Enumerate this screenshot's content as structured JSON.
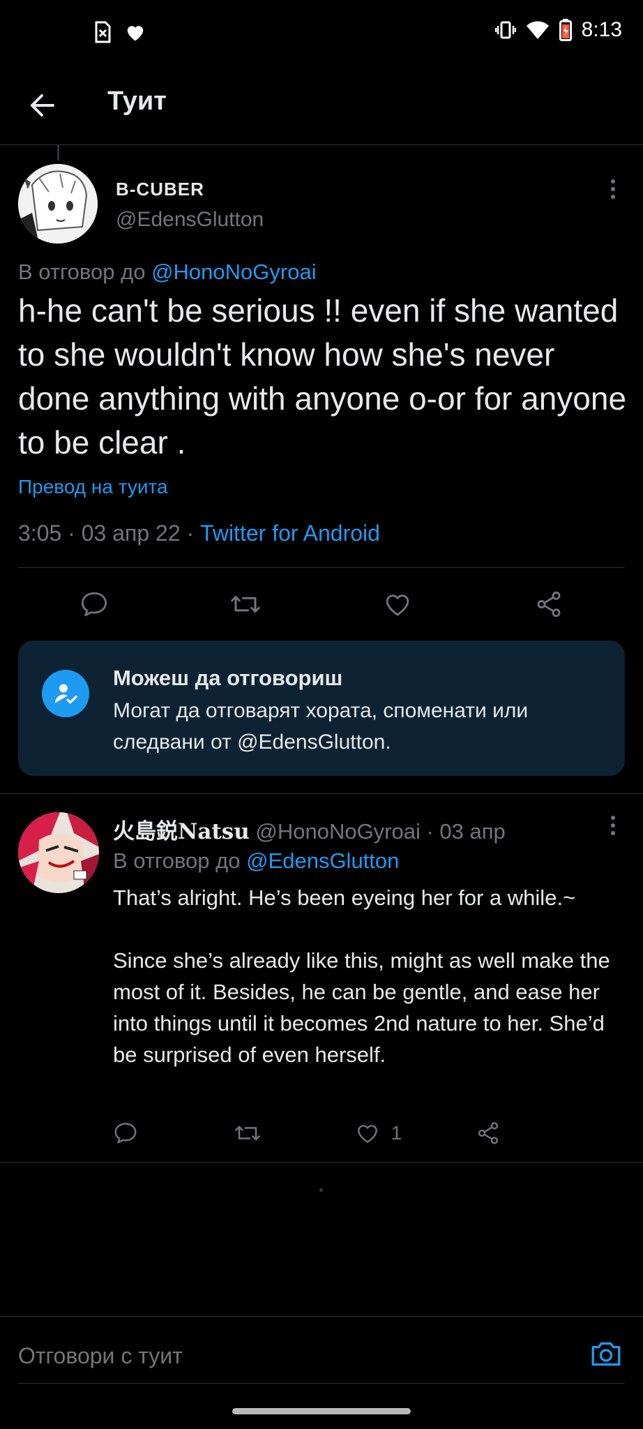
{
  "status_bar": {
    "time": "8:13",
    "left_icons": [
      "sim-error-icon",
      "heart-icon"
    ],
    "right_icons": [
      "vibrate-icon",
      "wifi-icon",
      "battery-low-icon"
    ]
  },
  "header": {
    "title": "Туит",
    "back_icon": "arrow-left-icon"
  },
  "main_tweet": {
    "display_name": "B-CUBER",
    "handle": "@EdensGlutton",
    "reply_prefix": "В отговор до ",
    "reply_to": "@HonoNoGyroai",
    "text": "h-he can't be serious !! even if she wanted to she wouldn't know how she's never done anything with anyone o-or for anyone to be clear .",
    "translate_label": "Превод на туита",
    "timestamp": "3:05 · 03 апр 22 · ",
    "source": "Twitter for Android",
    "actions": [
      "reply-icon",
      "retweet-icon",
      "like-icon",
      "share-icon"
    ]
  },
  "reply_info": {
    "title": "Можеш да отговориш",
    "body": "Могат да отговарят хората, споменати или следвани от @EdensGlutton."
  },
  "reply_tweet": {
    "display_name": "火島鋭Natsu",
    "handle": "@HonoNoGyroai",
    "date": " · 03 апр",
    "reply_prefix": "В отговор до ",
    "reply_to": "@EdensGlutton",
    "paragraph_1": "That’s alright. He’s been eyeing her for a while.~",
    "paragraph_2": "Since she’s already like this, might as well make the most of it. Besides, he can be gentle, and ease her into things until it becomes 2nd nature to her. She’d be surprised of even herself.",
    "like_count": "1"
  },
  "compose": {
    "placeholder": "Отговори с туит",
    "camera_icon": "camera-icon"
  },
  "colors": {
    "background": "#000000",
    "accent": "#1d9bf0",
    "secondary_text": "#71767b",
    "info_box": "#0d2233"
  }
}
